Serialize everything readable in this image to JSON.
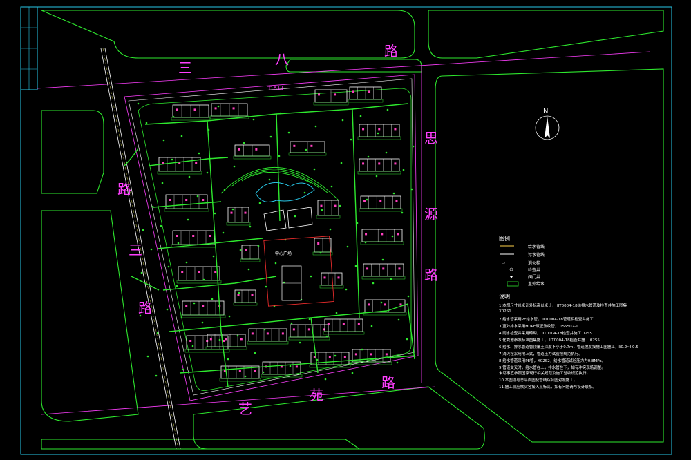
{
  "drawing": {
    "roads": {
      "north": [
        "三",
        "八",
        "路"
      ],
      "west": [
        "路",
        "三",
        "路"
      ],
      "east": [
        "思",
        "源",
        "路"
      ],
      "south": [
        "艺",
        "苑",
        "路"
      ]
    },
    "north_arrow": "N",
    "entrance": "主入口",
    "plaza": "中心广场",
    "legend": {
      "title": "图例",
      "items": [
        {
          "symbol": "yellow-line",
          "label": "给水管线"
        },
        {
          "symbol": "white-line",
          "label": "污水管线"
        },
        {
          "symbol": "hydrant",
          "label": "消火栓"
        },
        {
          "symbol": "circle",
          "label": "检查井"
        },
        {
          "symbol": "valve",
          "label": "阀门井"
        },
        {
          "symbol": "green-box",
          "label": "室外给水"
        }
      ]
    },
    "notes": {
      "title": "说明",
      "lines": [
        "1.本图尺寸以米计外标高以米计，  IIT0004-18给排水管道及检查井施工图集",
        "   X02S1",
        "2.给水管采用PE给水管，   IIT0004-18管道及检查井施工",
        "3.室外排水采用HDPE双壁波纹管，   05S502-1",
        "4.雨水检查井采用砖砌，           IIT0004-18检查井施工             02S5",
        "5.化粪池参照标准图集施工，        IIT0004-18检查井施工             02S5",
        "6.给水、排水管道管顶覆土深度不小于0.7m，管道坡度按施工图施工，Ii0.2~Ii0.5",
        "7.消火栓采用地上式，管道压力试验按规范执行。",
        "8.给水管道采用PE管，X02S2，给水管道试验压力为0.8MPa。",
        "9.管道交叉时，给水管在上，排水管在下，如有冲突现场调整。",
        "   未尽事宜参照国家现行相关规范及施工验收规范执行。",
        "10.本图须与总平面图及管线综合图对照施工。",
        "11.施工前应核实各接入点标高，如有问题请与设计联系。"
      ]
    }
  }
}
